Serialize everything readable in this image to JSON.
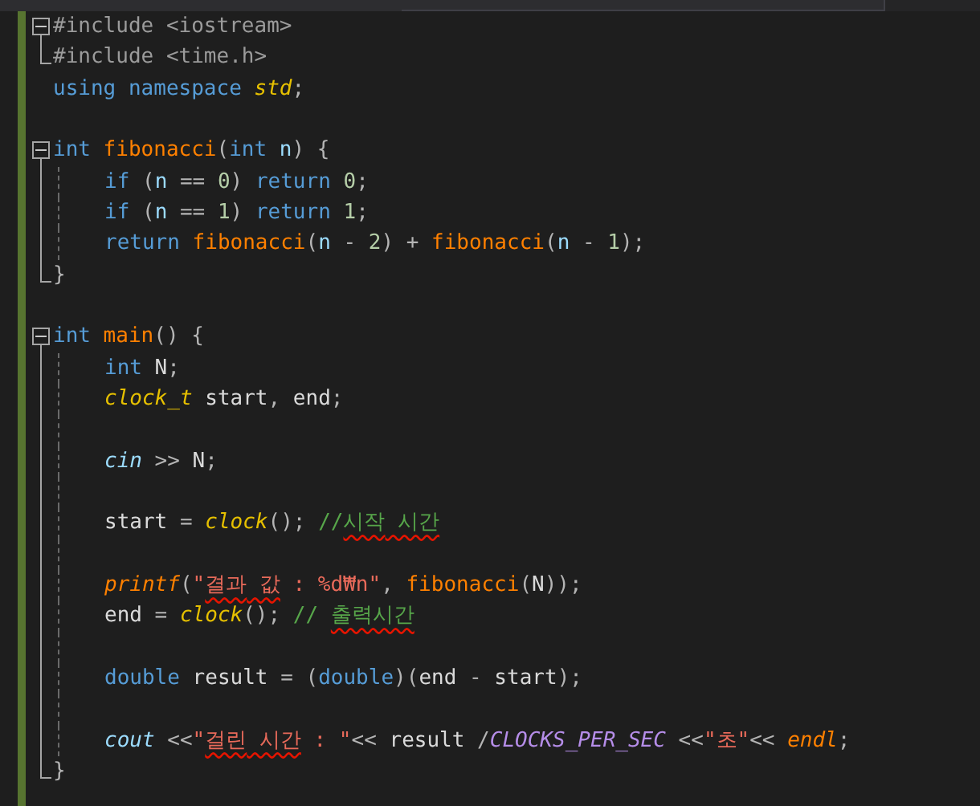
{
  "editor": {
    "lines": [
      {
        "kind": "fold-start",
        "expanded": true,
        "indented": false,
        "tokens": [
          {
            "text": "#include",
            "kind": "preproc"
          },
          {
            "text": " <iostream>",
            "kind": "preproc"
          }
        ]
      },
      {
        "kind": "fold-end",
        "indented": false,
        "tokens": [
          {
            "text": "#include",
            "kind": "preproc"
          },
          {
            "text": " <time.h>",
            "kind": "preproc"
          }
        ]
      },
      {
        "kind": "plain",
        "indented": false,
        "tokens": [
          {
            "text": "using",
            "kind": "keyword"
          },
          {
            "text": " namespace",
            "kind": "keyword"
          },
          {
            "text": " std",
            "kind": "type"
          },
          {
            "text": ";",
            "kind": "punct"
          }
        ]
      },
      {
        "kind": "plain",
        "indented": false
      },
      {
        "kind": "fold-start",
        "expanded": true,
        "indented": false,
        "tokens": [
          {
            "text": "int",
            "kind": "keyword"
          },
          {
            "text": " fibonacci",
            "kind": "function"
          },
          {
            "text": "(",
            "kind": "punct"
          },
          {
            "text": "int",
            "kind": "keyword"
          },
          {
            "text": " n",
            "kind": "param"
          },
          {
            "text": ") {",
            "kind": "punct"
          }
        ]
      },
      {
        "kind": "fold-inside",
        "indented": true,
        "tokens": [
          {
            "text": "if",
            "kind": "keyword"
          },
          {
            "text": " (",
            "kind": "punct"
          },
          {
            "text": "n",
            "kind": "param"
          },
          {
            "text": " == ",
            "kind": "punct"
          },
          {
            "text": "0",
            "kind": "number"
          },
          {
            "text": ") ",
            "kind": "punct"
          },
          {
            "text": "return",
            "kind": "keyword"
          },
          {
            "text": " 0",
            "kind": "number"
          },
          {
            "text": ";",
            "kind": "punct"
          }
        ]
      },
      {
        "kind": "fold-inside",
        "indented": true,
        "tokens": [
          {
            "text": "if",
            "kind": "keyword"
          },
          {
            "text": " (",
            "kind": "punct"
          },
          {
            "text": "n",
            "kind": "param"
          },
          {
            "text": " == ",
            "kind": "punct"
          },
          {
            "text": "1",
            "kind": "number"
          },
          {
            "text": ") ",
            "kind": "punct"
          },
          {
            "text": "return",
            "kind": "keyword"
          },
          {
            "text": " 1",
            "kind": "number"
          },
          {
            "text": ";",
            "kind": "punct"
          }
        ]
      },
      {
        "kind": "fold-inside",
        "indented": true,
        "tokens": [
          {
            "text": "return",
            "kind": "keyword"
          },
          {
            "text": " fibonacci",
            "kind": "function"
          },
          {
            "text": "(",
            "kind": "punct"
          },
          {
            "text": "n",
            "kind": "param"
          },
          {
            "text": " - ",
            "kind": "punct"
          },
          {
            "text": "2",
            "kind": "number"
          },
          {
            "text": ") + ",
            "kind": "punct"
          },
          {
            "text": "fibonacci",
            "kind": "function"
          },
          {
            "text": "(",
            "kind": "punct"
          },
          {
            "text": "n",
            "kind": "param"
          },
          {
            "text": " - ",
            "kind": "punct"
          },
          {
            "text": "1",
            "kind": "number"
          },
          {
            "text": ");",
            "kind": "punct"
          }
        ]
      },
      {
        "kind": "fold-end",
        "indented": false,
        "tokens": [
          {
            "text": "}",
            "kind": "punct"
          }
        ]
      },
      {
        "kind": "plain",
        "indented": false
      },
      {
        "kind": "fold-start",
        "expanded": true,
        "indented": false,
        "tokens": [
          {
            "text": "int",
            "kind": "keyword"
          },
          {
            "text": " main",
            "kind": "function"
          },
          {
            "text": "() {",
            "kind": "punct"
          }
        ]
      },
      {
        "kind": "fold-inside",
        "indented": true,
        "tokens": [
          {
            "text": "int",
            "kind": "keyword"
          },
          {
            "text": " N",
            "kind": "variable"
          },
          {
            "text": ";",
            "kind": "punct"
          }
        ]
      },
      {
        "kind": "fold-inside",
        "indented": true,
        "tokens": [
          {
            "text": "clock_t",
            "kind": "type"
          },
          {
            "text": " start",
            "kind": "variable"
          },
          {
            "text": ", ",
            "kind": "punct"
          },
          {
            "text": "end",
            "kind": "variable"
          },
          {
            "text": ";",
            "kind": "punct"
          }
        ]
      },
      {
        "kind": "fold-inside",
        "indented": true
      },
      {
        "kind": "fold-inside",
        "indented": true,
        "tokens": [
          {
            "text": "cin",
            "kind": "stream"
          },
          {
            "text": " >> ",
            "kind": "punct"
          },
          {
            "text": "N",
            "kind": "variable"
          },
          {
            "text": ";",
            "kind": "punct"
          }
        ]
      },
      {
        "kind": "fold-inside",
        "indented": true
      },
      {
        "kind": "fold-inside",
        "indented": true,
        "tokens": [
          {
            "text": "start",
            "kind": "variable"
          },
          {
            "text": " = ",
            "kind": "punct"
          },
          {
            "text": "clock",
            "kind": "type"
          },
          {
            "text": "(); ",
            "kind": "punct"
          },
          {
            "text": "//",
            "kind": "comment"
          },
          {
            "text": "시작",
            "kind": "comment",
            "squiggle": true
          },
          {
            "text": " 시간",
            "kind": "comment",
            "squiggle": true
          }
        ]
      },
      {
        "kind": "fold-inside",
        "indented": true
      },
      {
        "kind": "fold-inside",
        "indented": true,
        "tokens": [
          {
            "text": "printf",
            "kind": "macro"
          },
          {
            "text": "(",
            "kind": "punct"
          },
          {
            "text": "\"",
            "kind": "string"
          },
          {
            "text": "결과",
            "kind": "string",
            "squiggle": true
          },
          {
            "text": " 값",
            "kind": "string",
            "squiggle": true
          },
          {
            "text": " : %d₩n\"",
            "kind": "string"
          },
          {
            "text": ", ",
            "kind": "punct"
          },
          {
            "text": "fibonacci",
            "kind": "function"
          },
          {
            "text": "(",
            "kind": "punct"
          },
          {
            "text": "N",
            "kind": "variable"
          },
          {
            "text": "));",
            "kind": "punct"
          }
        ]
      },
      {
        "kind": "fold-inside",
        "indented": true,
        "tokens": [
          {
            "text": "end",
            "kind": "variable"
          },
          {
            "text": " = ",
            "kind": "punct"
          },
          {
            "text": "clock",
            "kind": "type"
          },
          {
            "text": "(); ",
            "kind": "punct"
          },
          {
            "text": "// ",
            "kind": "comment"
          },
          {
            "text": "출력시간",
            "kind": "comment",
            "squiggle": true
          }
        ]
      },
      {
        "kind": "fold-inside",
        "indented": true
      },
      {
        "kind": "fold-inside",
        "indented": true,
        "tokens": [
          {
            "text": "double",
            "kind": "keyword"
          },
          {
            "text": " result",
            "kind": "variable"
          },
          {
            "text": " = (",
            "kind": "punct"
          },
          {
            "text": "double",
            "kind": "keyword"
          },
          {
            "text": ")(",
            "kind": "punct"
          },
          {
            "text": "end",
            "kind": "variable"
          },
          {
            "text": " - ",
            "kind": "punct"
          },
          {
            "text": "start",
            "kind": "variable"
          },
          {
            "text": ");",
            "kind": "punct"
          }
        ]
      },
      {
        "kind": "fold-inside",
        "indented": true
      },
      {
        "kind": "fold-inside",
        "indented": true,
        "tokens": [
          {
            "text": "cout",
            "kind": "stream"
          },
          {
            "text": " <<",
            "kind": "punct"
          },
          {
            "text": "\"",
            "kind": "string"
          },
          {
            "text": "걸린",
            "kind": "string",
            "squiggle": true
          },
          {
            "text": " 시간",
            "kind": "string",
            "squiggle": true
          },
          {
            "text": " : \"",
            "kind": "string"
          },
          {
            "text": "<< ",
            "kind": "punct"
          },
          {
            "text": "result",
            "kind": "variable"
          },
          {
            "text": " /",
            "kind": "punct"
          },
          {
            "text": "CLOCKS_PER_SEC",
            "kind": "constant"
          },
          {
            "text": " <<",
            "kind": "punct"
          },
          {
            "text": "\"초\"",
            "kind": "string"
          },
          {
            "text": "<< ",
            "kind": "punct"
          },
          {
            "text": "endl",
            "kind": "macro"
          },
          {
            "text": ";",
            "kind": "punct"
          }
        ]
      },
      {
        "kind": "fold-end",
        "indented": false,
        "tokens": [
          {
            "text": "}",
            "kind": "punct"
          }
        ]
      }
    ]
  }
}
